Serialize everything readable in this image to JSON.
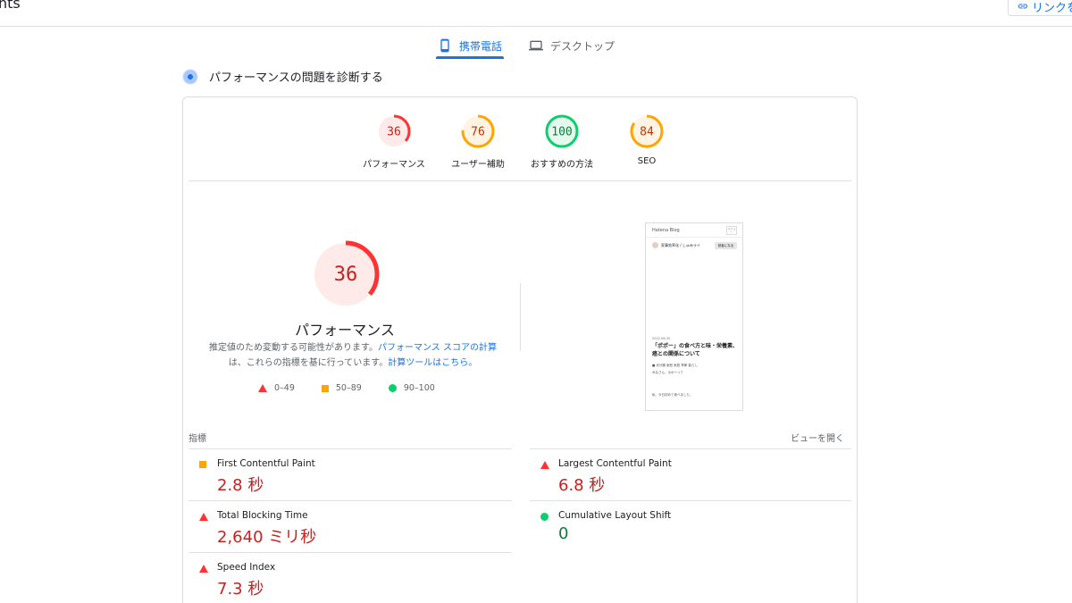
{
  "header": {
    "left_text": "nts",
    "share_label": "リンクを"
  },
  "tabs": [
    {
      "label": "携帯電話",
      "active": true,
      "icon": "smartphone-icon"
    },
    {
      "label": "デスクトップ",
      "active": false,
      "icon": "laptop-icon"
    }
  ],
  "diagnose": {
    "title": "パフォーマンスの問題を診断する"
  },
  "gauges": [
    {
      "score": "36",
      "label": "パフォーマンス",
      "value": 36,
      "color": "#ff3333",
      "bg": "#fdeae9"
    },
    {
      "score": "76",
      "label": "ユーザー補助",
      "value": 76,
      "color": "#ffa400",
      "bg": "#fff4e3"
    },
    {
      "score": "100",
      "label": "おすすめの方法",
      "value": 100,
      "color": "#0cce6b",
      "bg": "#e6f9ef"
    },
    {
      "score": "84",
      "label": "SEO",
      "value": 84,
      "color": "#ffa400",
      "bg": "#fff4e3"
    }
  ],
  "performance": {
    "score": "36",
    "value": 36,
    "label": "パフォーマンス",
    "desc_part1": "推定値のため変動する可能性があります。",
    "desc_link1": "パフォーマンス スコアの計算",
    "desc_part2": "は、これらの指標を基に行っています。",
    "desc_link2": "計算ツールはこちら。"
  },
  "legend": [
    {
      "range": "0–49",
      "shape": "triangle",
      "color": "#ff3333"
    },
    {
      "range": "50–89",
      "shape": "square",
      "color": "#ffa400"
    },
    {
      "range": "90–100",
      "shape": "circle",
      "color": "#0cce6b"
    }
  ],
  "thumbnail": {
    "logo": "Hatena Blog",
    "menu": "メニュー",
    "author": "家事効率化 / しゅみライ",
    "follow": "読者になる",
    "date": "2022-08-30",
    "title": "「ポポー」の食べ方と味・栄養素、癌との関係について",
    "tags": "■ 未分類  家庭  家庭  季節  暮らし",
    "body": "みなさん、ポポーって",
    "foot": "私、今日初めて食べました。"
  },
  "metrics": {
    "section_label": "指標",
    "expand_label": "ビューを開く",
    "items": [
      {
        "name": "First Contentful Paint",
        "value": "2.8 秒",
        "status": "average"
      },
      {
        "name": "Largest Contentful Paint",
        "value": "6.8 秒",
        "status": "fail"
      },
      {
        "name": "Total Blocking Time",
        "value": "2,640 ミリ秒",
        "status": "fail"
      },
      {
        "name": "Cumulative Layout Shift",
        "value": "0",
        "status": "pass"
      },
      {
        "name": "Speed Index",
        "value": "7.3 秒",
        "status": "fail"
      }
    ]
  }
}
